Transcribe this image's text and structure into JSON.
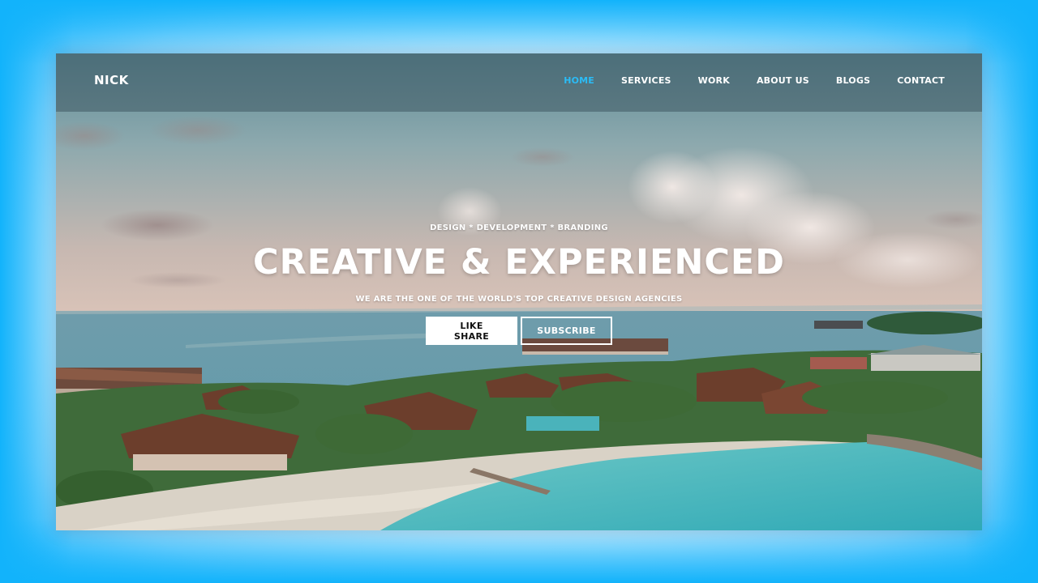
{
  "site": {
    "logo": "NICK",
    "nav": [
      {
        "label": "HOME",
        "active": true
      },
      {
        "label": "SERVICES",
        "active": false
      },
      {
        "label": "WORK",
        "active": false
      },
      {
        "label": "ABOUT US",
        "active": false
      },
      {
        "label": "BLOGS",
        "active": false
      },
      {
        "label": "CONTACT",
        "active": false
      }
    ]
  },
  "hero": {
    "tagline": "DESIGN * DEVELOPMENT * BRANDING",
    "headline": "CREATIVE & EXPERIENCED",
    "subline": "WE ARE THE ONE OF THE WORLD'S TOP CREATIVE DESIGN AGENCIES",
    "primary_button": "LIKE SHARE",
    "secondary_button": "SUBSCRIBE"
  },
  "colors": {
    "accent": "#2bbcf6",
    "frame_glow": "#12b3fb",
    "nav_overlay": "#3e5862"
  }
}
